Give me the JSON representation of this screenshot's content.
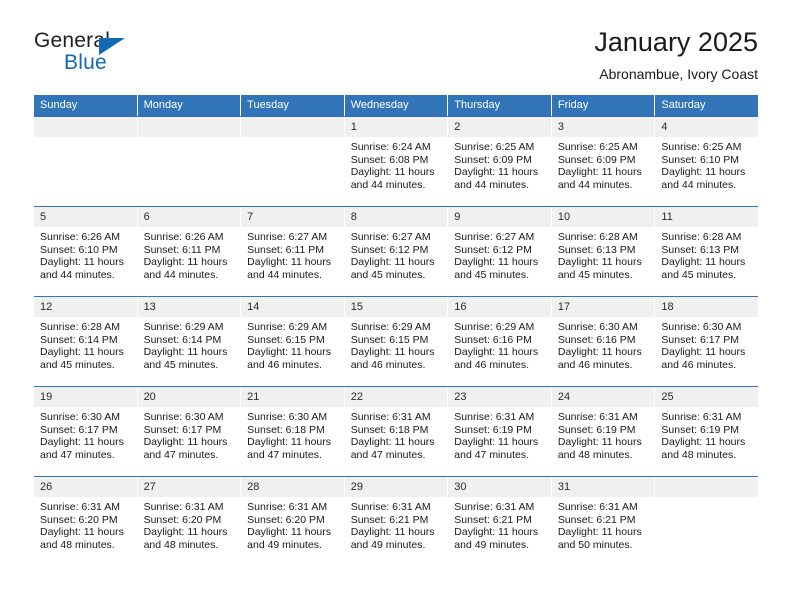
{
  "logo": {
    "primary_text": "General",
    "secondary_text": "Blue",
    "accent_color": "#1268b3",
    "triangle_icon": "triangle-icon"
  },
  "header": {
    "title": "January 2025",
    "subtitle": "Abronambue, Ivory Coast"
  },
  "theme": {
    "header_blue": "#3175b8",
    "daynum_gray": "#f0f0f0",
    "text_color": "#1a1a1a"
  },
  "weekdays": [
    "Sunday",
    "Monday",
    "Tuesday",
    "Wednesday",
    "Thursday",
    "Friday",
    "Saturday"
  ],
  "labels": {
    "sunrise_prefix": "Sunrise: ",
    "sunset_prefix": "Sunset: ",
    "daylight_prefix": "Daylight: "
  },
  "weeks": [
    [
      {
        "day": "",
        "empty": true
      },
      {
        "day": "",
        "empty": true
      },
      {
        "day": "",
        "empty": true
      },
      {
        "day": "1",
        "sunrise": "Sunrise: 6:24 AM",
        "sunset": "Sunset: 6:08 PM",
        "daylight": "Daylight: 11 hours and 44 minutes."
      },
      {
        "day": "2",
        "sunrise": "Sunrise: 6:25 AM",
        "sunset": "Sunset: 6:09 PM",
        "daylight": "Daylight: 11 hours and 44 minutes."
      },
      {
        "day": "3",
        "sunrise": "Sunrise: 6:25 AM",
        "sunset": "Sunset: 6:09 PM",
        "daylight": "Daylight: 11 hours and 44 minutes."
      },
      {
        "day": "4",
        "sunrise": "Sunrise: 6:25 AM",
        "sunset": "Sunset: 6:10 PM",
        "daylight": "Daylight: 11 hours and 44 minutes."
      }
    ],
    [
      {
        "day": "5",
        "sunrise": "Sunrise: 6:26 AM",
        "sunset": "Sunset: 6:10 PM",
        "daylight": "Daylight: 11 hours and 44 minutes."
      },
      {
        "day": "6",
        "sunrise": "Sunrise: 6:26 AM",
        "sunset": "Sunset: 6:11 PM",
        "daylight": "Daylight: 11 hours and 44 minutes."
      },
      {
        "day": "7",
        "sunrise": "Sunrise: 6:27 AM",
        "sunset": "Sunset: 6:11 PM",
        "daylight": "Daylight: 11 hours and 44 minutes."
      },
      {
        "day": "8",
        "sunrise": "Sunrise: 6:27 AM",
        "sunset": "Sunset: 6:12 PM",
        "daylight": "Daylight: 11 hours and 45 minutes."
      },
      {
        "day": "9",
        "sunrise": "Sunrise: 6:27 AM",
        "sunset": "Sunset: 6:12 PM",
        "daylight": "Daylight: 11 hours and 45 minutes."
      },
      {
        "day": "10",
        "sunrise": "Sunrise: 6:28 AM",
        "sunset": "Sunset: 6:13 PM",
        "daylight": "Daylight: 11 hours and 45 minutes."
      },
      {
        "day": "11",
        "sunrise": "Sunrise: 6:28 AM",
        "sunset": "Sunset: 6:13 PM",
        "daylight": "Daylight: 11 hours and 45 minutes."
      }
    ],
    [
      {
        "day": "12",
        "sunrise": "Sunrise: 6:28 AM",
        "sunset": "Sunset: 6:14 PM",
        "daylight": "Daylight: 11 hours and 45 minutes."
      },
      {
        "day": "13",
        "sunrise": "Sunrise: 6:29 AM",
        "sunset": "Sunset: 6:14 PM",
        "daylight": "Daylight: 11 hours and 45 minutes."
      },
      {
        "day": "14",
        "sunrise": "Sunrise: 6:29 AM",
        "sunset": "Sunset: 6:15 PM",
        "daylight": "Daylight: 11 hours and 46 minutes."
      },
      {
        "day": "15",
        "sunrise": "Sunrise: 6:29 AM",
        "sunset": "Sunset: 6:15 PM",
        "daylight": "Daylight: 11 hours and 46 minutes."
      },
      {
        "day": "16",
        "sunrise": "Sunrise: 6:29 AM",
        "sunset": "Sunset: 6:16 PM",
        "daylight": "Daylight: 11 hours and 46 minutes."
      },
      {
        "day": "17",
        "sunrise": "Sunrise: 6:30 AM",
        "sunset": "Sunset: 6:16 PM",
        "daylight": "Daylight: 11 hours and 46 minutes."
      },
      {
        "day": "18",
        "sunrise": "Sunrise: 6:30 AM",
        "sunset": "Sunset: 6:17 PM",
        "daylight": "Daylight: 11 hours and 46 minutes."
      }
    ],
    [
      {
        "day": "19",
        "sunrise": "Sunrise: 6:30 AM",
        "sunset": "Sunset: 6:17 PM",
        "daylight": "Daylight: 11 hours and 47 minutes."
      },
      {
        "day": "20",
        "sunrise": "Sunrise: 6:30 AM",
        "sunset": "Sunset: 6:17 PM",
        "daylight": "Daylight: 11 hours and 47 minutes."
      },
      {
        "day": "21",
        "sunrise": "Sunrise: 6:30 AM",
        "sunset": "Sunset: 6:18 PM",
        "daylight": "Daylight: 11 hours and 47 minutes."
      },
      {
        "day": "22",
        "sunrise": "Sunrise: 6:31 AM",
        "sunset": "Sunset: 6:18 PM",
        "daylight": "Daylight: 11 hours and 47 minutes."
      },
      {
        "day": "23",
        "sunrise": "Sunrise: 6:31 AM",
        "sunset": "Sunset: 6:19 PM",
        "daylight": "Daylight: 11 hours and 47 minutes."
      },
      {
        "day": "24",
        "sunrise": "Sunrise: 6:31 AM",
        "sunset": "Sunset: 6:19 PM",
        "daylight": "Daylight: 11 hours and 48 minutes."
      },
      {
        "day": "25",
        "sunrise": "Sunrise: 6:31 AM",
        "sunset": "Sunset: 6:19 PM",
        "daylight": "Daylight: 11 hours and 48 minutes."
      }
    ],
    [
      {
        "day": "26",
        "sunrise": "Sunrise: 6:31 AM",
        "sunset": "Sunset: 6:20 PM",
        "daylight": "Daylight: 11 hours and 48 minutes."
      },
      {
        "day": "27",
        "sunrise": "Sunrise: 6:31 AM",
        "sunset": "Sunset: 6:20 PM",
        "daylight": "Daylight: 11 hours and 48 minutes."
      },
      {
        "day": "28",
        "sunrise": "Sunrise: 6:31 AM",
        "sunset": "Sunset: 6:20 PM",
        "daylight": "Daylight: 11 hours and 49 minutes."
      },
      {
        "day": "29",
        "sunrise": "Sunrise: 6:31 AM",
        "sunset": "Sunset: 6:21 PM",
        "daylight": "Daylight: 11 hours and 49 minutes."
      },
      {
        "day": "30",
        "sunrise": "Sunrise: 6:31 AM",
        "sunset": "Sunset: 6:21 PM",
        "daylight": "Daylight: 11 hours and 49 minutes."
      },
      {
        "day": "31",
        "sunrise": "Sunrise: 6:31 AM",
        "sunset": "Sunset: 6:21 PM",
        "daylight": "Daylight: 11 hours and 50 minutes."
      },
      {
        "day": "",
        "empty": true
      }
    ]
  ]
}
